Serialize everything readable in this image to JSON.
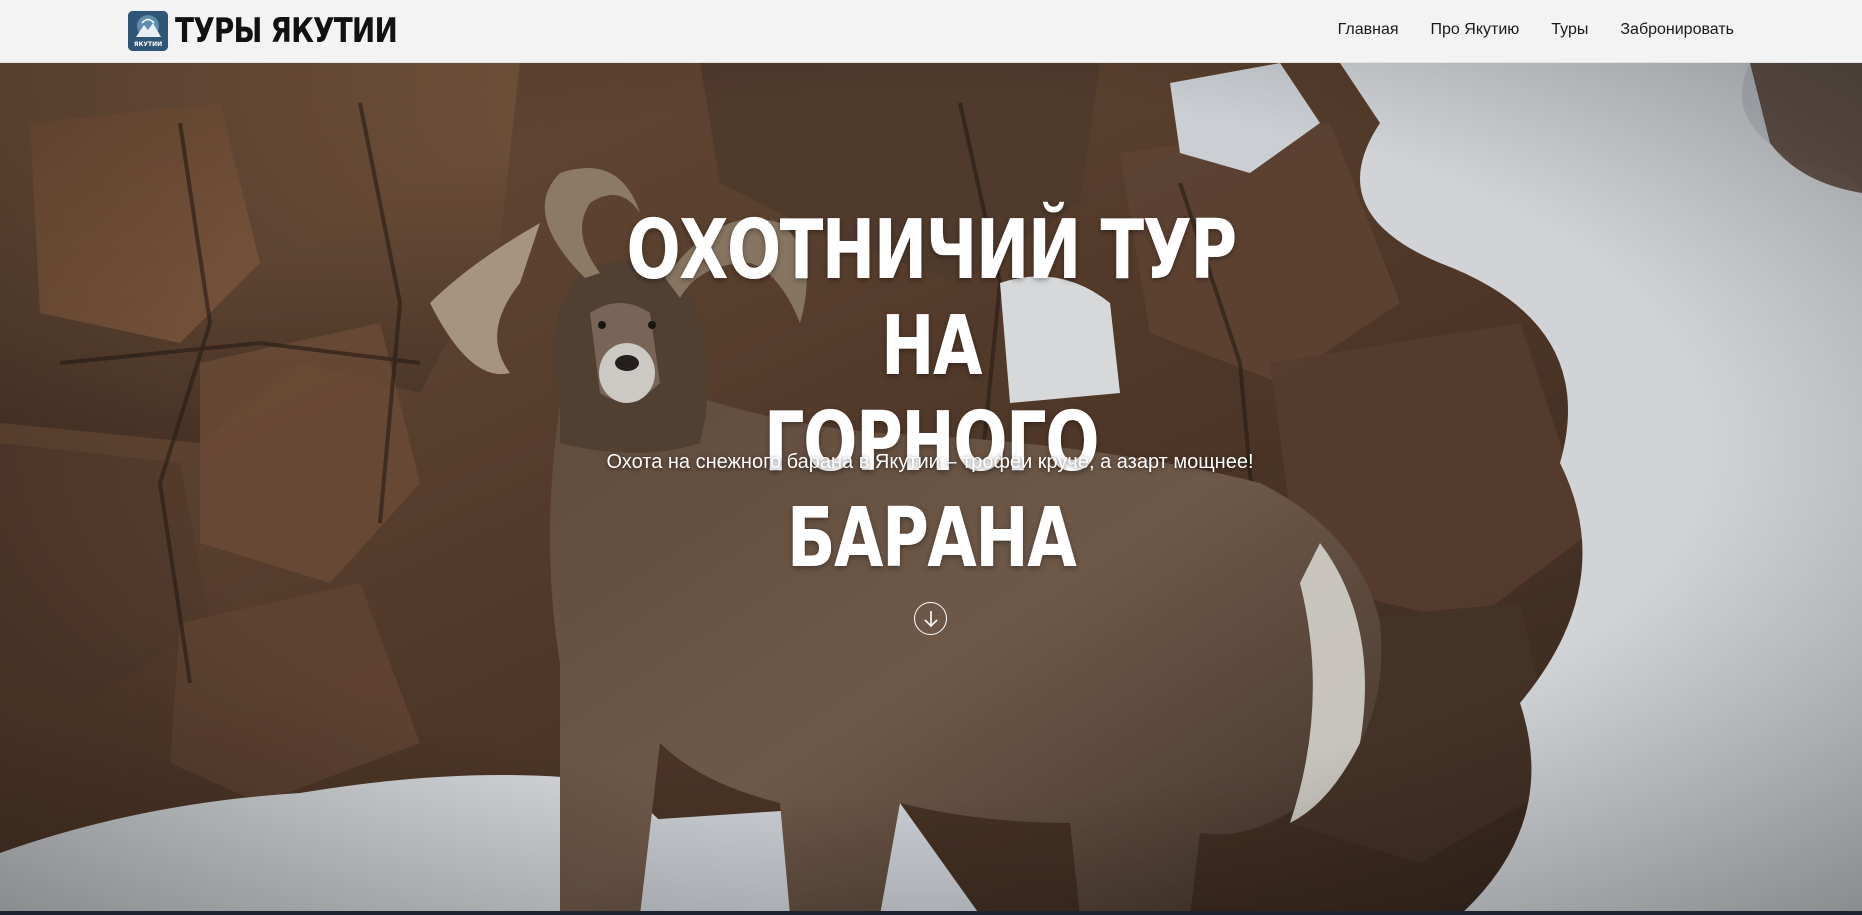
{
  "header": {
    "brand_name": "ТУРЫ ЯКУТИИ",
    "logo_text": "ЯКУТИИ",
    "nav": [
      {
        "label": "Главная"
      },
      {
        "label": "Про Якутию"
      },
      {
        "label": "Туры"
      },
      {
        "label": "Забронировать"
      }
    ]
  },
  "hero": {
    "title_line1": "ОХОТНИЧИЙ ТУР НА",
    "title_line2": "ГОРНОГО БАРАНА",
    "subtitle": "Охота на снежного барана в Якутии – трофеи круче, а азарт мощнее!",
    "scroll_icon": "arrow-down-circle-icon"
  },
  "colors": {
    "header_bg": "#f3f3f3",
    "hero_text": "#ffffff",
    "rock": "#6b4a35",
    "snow": "#eef1f5"
  }
}
